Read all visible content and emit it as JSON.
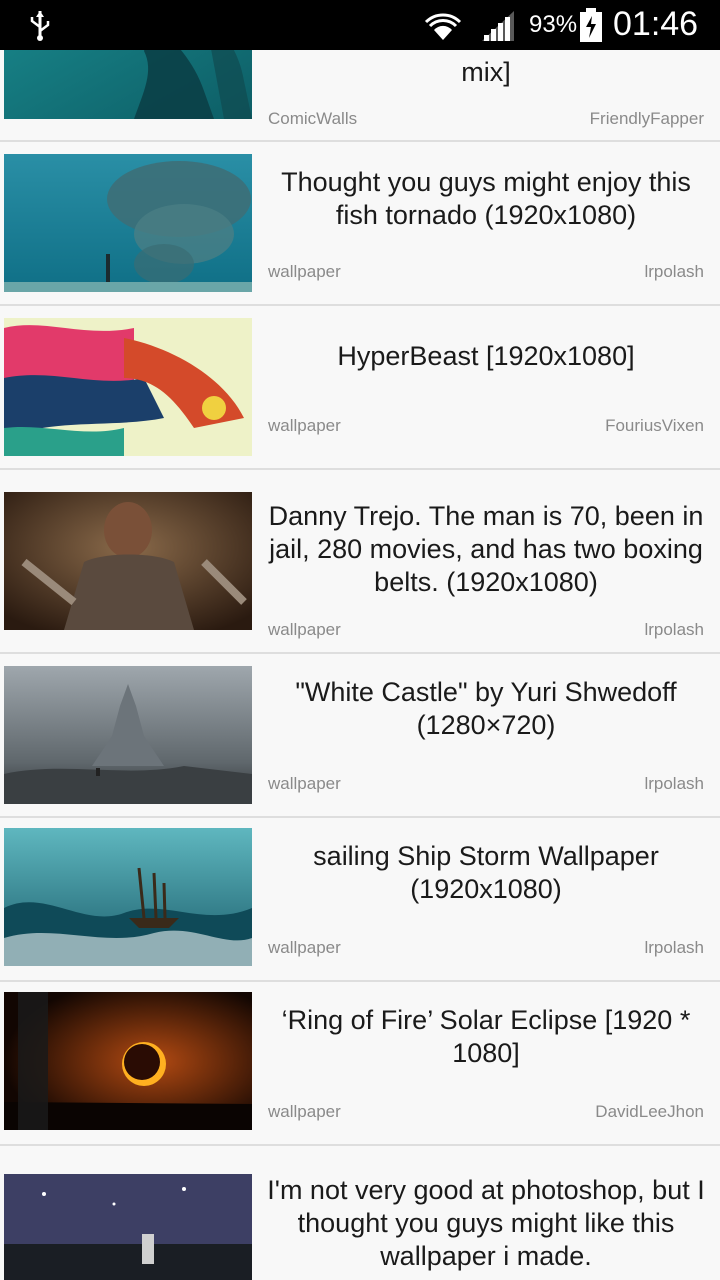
{
  "status_bar": {
    "battery_percent": "93%",
    "time": "01:46",
    "icons": [
      "usb-icon",
      "wifi-icon",
      "signal-icon",
      "battery-charging-icon"
    ]
  },
  "posts": [
    {
      "title": "[...] mix]",
      "title_visible": "mix]",
      "subreddit": "ComicWalls",
      "author": "FriendlyFapper",
      "thumb_icon": "underwater-figure-thumbnail"
    },
    {
      "title": "Thought you guys might enjoy this fish tornado (1920x1080)",
      "subreddit": "wallpaper",
      "author": "lrpolash",
      "thumb_icon": "fish-tornado-thumbnail"
    },
    {
      "title": "HyperBeast [1920x1080]",
      "subreddit": "wallpaper",
      "author": "FouriusVixen",
      "thumb_icon": "hyperbeast-thumbnail"
    },
    {
      "title": "Danny Trejo. The man is 70, been in jail, 280 movies, and has two boxing belts. (1920x1080)",
      "subreddit": "wallpaper",
      "author": "lrpolash",
      "thumb_icon": "danny-trejo-thumbnail"
    },
    {
      "title": "\"White Castle\" by Yuri Shwedoff (1280×720)",
      "subreddit": "wallpaper",
      "author": "lrpolash",
      "thumb_icon": "white-castle-thumbnail"
    },
    {
      "title": "sailing Ship Storm Wallpaper (1920x1080)",
      "subreddit": "wallpaper",
      "author": "lrpolash",
      "thumb_icon": "sailing-ship-thumbnail"
    },
    {
      "title": "‘Ring of Fire’ Solar Eclipse [1920 * 1080]",
      "subreddit": "wallpaper",
      "author": "DavidLeeJhon",
      "thumb_icon": "solar-eclipse-thumbnail"
    },
    {
      "title": "I'm not very good at photoshop, but I thought you guys might like this wallpaper i made.",
      "subreddit": "",
      "author": "",
      "thumb_icon": "space-crowd-thumbnail"
    }
  ]
}
